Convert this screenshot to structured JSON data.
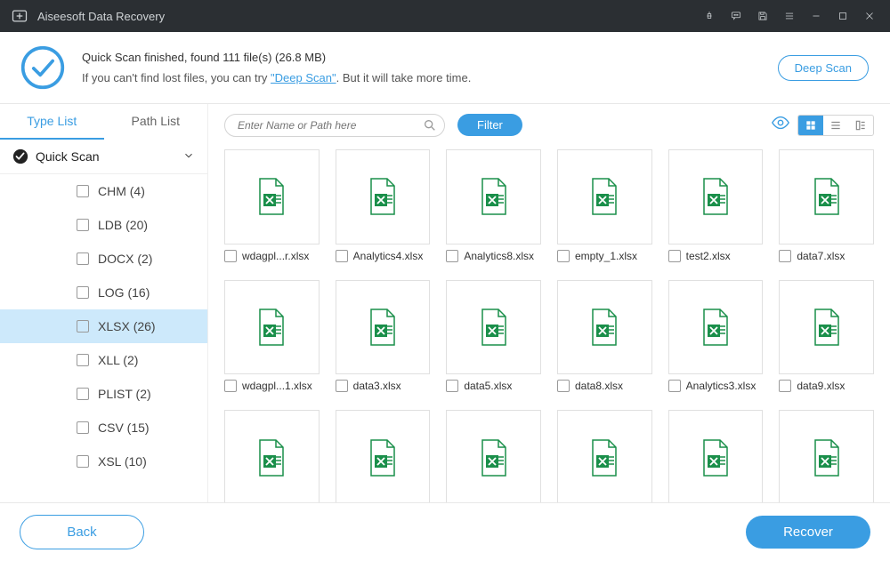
{
  "app": {
    "title": "Aiseesoft Data Recovery"
  },
  "status": {
    "line1": "Quick Scan finished, found 111 file(s) (26.8 MB)",
    "line2_a": "If you can't find lost files, you can try ",
    "line2_link": "\"Deep Scan\"",
    "line2_b": ". But it will take more time.",
    "deep_scan_btn": "Deep Scan"
  },
  "tabs": {
    "type_list": "Type List",
    "path_list": "Path List"
  },
  "group": {
    "label": "Quick Scan"
  },
  "types": [
    {
      "label": "CHM (4)"
    },
    {
      "label": "LDB (20)"
    },
    {
      "label": "DOCX (2)"
    },
    {
      "label": "LOG (16)"
    },
    {
      "label": "XLSX (26)",
      "selected": true
    },
    {
      "label": "XLL (2)"
    },
    {
      "label": "PLIST (2)"
    },
    {
      "label": "CSV (15)"
    },
    {
      "label": "XSL (10)"
    }
  ],
  "search": {
    "placeholder": "Enter Name or Path here"
  },
  "filter_label": "Filter",
  "files": [
    {
      "name": "wdagpl...r.xlsx"
    },
    {
      "name": "Analytics4.xlsx"
    },
    {
      "name": "Analytics8.xlsx"
    },
    {
      "name": "empty_1.xlsx"
    },
    {
      "name": "test2.xlsx"
    },
    {
      "name": "data7.xlsx"
    },
    {
      "name": "wdagpl...1.xlsx"
    },
    {
      "name": "data3.xlsx"
    },
    {
      "name": "data5.xlsx"
    },
    {
      "name": "data8.xlsx"
    },
    {
      "name": "Analytics3.xlsx"
    },
    {
      "name": "data9.xlsx"
    },
    {
      "name": ""
    },
    {
      "name": ""
    },
    {
      "name": ""
    },
    {
      "name": ""
    },
    {
      "name": ""
    },
    {
      "name": ""
    }
  ],
  "footer": {
    "back": "Back",
    "recover": "Recover"
  }
}
